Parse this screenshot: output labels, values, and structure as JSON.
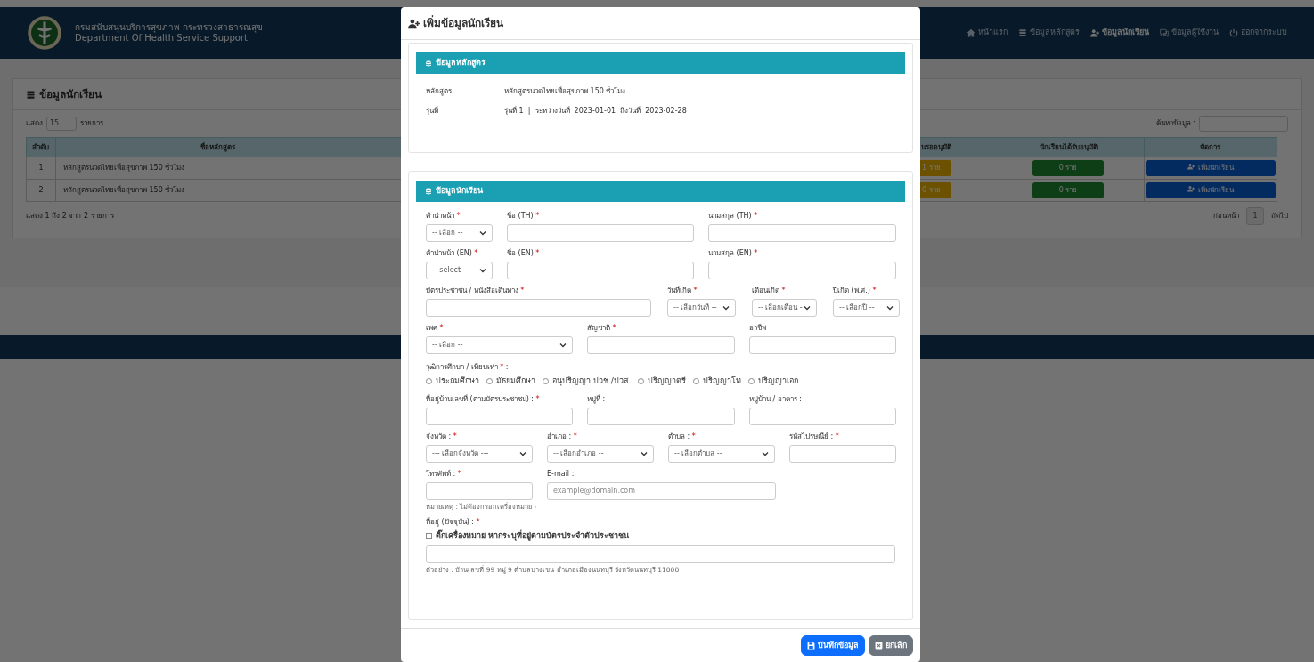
{
  "header": {
    "org_th": "กรมสนับสนุนบริการสุขภาพ กระทรวงสาธารณสุข",
    "org_en": "Department Of Health Service Support",
    "nav": [
      {
        "label": "หน้าแรก",
        "selected": false
      },
      {
        "label": "ข้อมูลหลักสูตร",
        "selected": false
      },
      {
        "label": "ข้อมูลนักเรียน",
        "selected": true
      },
      {
        "label": "ข้อมูลผู้ใช้งาน",
        "selected": false
      },
      {
        "label": "ออกจากระบบ",
        "selected": false
      }
    ]
  },
  "page": {
    "title": "ข้อมูลนักเรียน",
    "length_prefix": "แสดง",
    "length_value": "15",
    "length_suffix": "รายการ",
    "search_label": "ค้นหาข้อมูล :",
    "columns": [
      "ลำดับ",
      "ชื่อหลักสูตร",
      "นรออนุมัติ",
      "นักเรียนได้รับอนุมัติ",
      "จัดการ"
    ],
    "rows": [
      {
        "no": "1",
        "course": "หลักสูตรนวดไทยเพื่อสุขภาพ 150 ชั่วโมง",
        "pending": "1 ราย",
        "approved": "0 ราย",
        "action": "เพิ่มนักเรียน"
      },
      {
        "no": "2",
        "course": "หลักสูตรนวดไทยเพื่อสุขภาพ 150 ชั่วโมง",
        "pending": "0 ราย",
        "approved": "0 ราย",
        "action": "เพิ่มนักเรียน"
      }
    ],
    "info": "แสดง 1 ถึง 2 จาก 2 รายการ",
    "pagination": {
      "prev": "ก่อนหน้า",
      "page": "1",
      "next": "ถัดไป"
    }
  },
  "modal": {
    "title": "เพิ่มข้อมูลนักเรียน",
    "course_panel": {
      "title": "ข้อมูลหลักสูตร",
      "fields": [
        {
          "label": "หลักสูตร",
          "value": "หลักสูตรนวดไทยเพื่อสุขภาพ 150 ชั่วโมง"
        },
        {
          "label": "รุ่นที่",
          "value": "รุ่นที่ 1  |  ระหว่างวันที่  2023-01-01  ถึงวันที่  2023-02-28"
        }
      ]
    },
    "student_panel": {
      "title": "ข้อมูลนักเรียน",
      "rows": [
        {
          "kind": "fields",
          "fields": [
            {
              "kind": "select",
              "label": "คำนำหน้า",
              "required": "*",
              "value": "-- เลือก --"
            },
            {
              "kind": "input",
              "label": "ชื่อ (TH)",
              "required": "*"
            },
            {
              "kind": "input",
              "label": "นามสกุล (TH)",
              "required": "*"
            }
          ]
        },
        {
          "kind": "fields",
          "fields": [
            {
              "kind": "select",
              "label": "คำนำหน้า (EN)",
              "required": "*",
              "value": "-- select --"
            },
            {
              "kind": "input",
              "label": "ชื่อ (EN)",
              "required": "*"
            },
            {
              "kind": "input",
              "label": "นามสกุล (EN)",
              "required": "*"
            }
          ]
        },
        {
          "kind": "fields",
          "fields": [
            {
              "kind": "input",
              "label": "บัตรประชาชน / หนังสือเดินทาง",
              "required": "*"
            },
            {
              "kind": "select",
              "label": "วันที่เกิด",
              "required": "*",
              "value": "-- เลือกวันที่ --"
            },
            {
              "kind": "select",
              "label": "เดือนเกิด",
              "required": "*",
              "value": "-- เลือกเดือน -"
            },
            {
              "kind": "select",
              "label": "ปีเกิด (พ.ศ.)",
              "required": "*",
              "value": "-- เลือกปี --"
            }
          ]
        },
        {
          "kind": "fields",
          "fields": [
            {
              "kind": "select",
              "label": "เพศ",
              "required": "*",
              "value": "-- เลือก --"
            },
            {
              "kind": "input",
              "label": "สัญชาติ",
              "required": "*"
            },
            {
              "kind": "input",
              "label": "อาชีพ"
            }
          ]
        },
        {
          "kind": "radio",
          "label": "วุฒิการศึกษา / เทียบเท่า",
          "required": "*",
          "suffix": ":",
          "options": [
            {
              "label": "ประถมศึกษา",
              "selected": false
            },
            {
              "label": "มัธยมศึกษา",
              "selected": false
            },
            {
              "label": "อนุปริญญา ปวช./ปวส.",
              "selected": false
            },
            {
              "label": "ปริญญาตรี",
              "selected": false
            },
            {
              "label": "ปริญญาโท",
              "selected": false
            },
            {
              "label": "ปริญญาเอก",
              "selected": false
            }
          ]
        },
        {
          "kind": "fields",
          "fields": [
            {
              "kind": "input",
              "label": "ที่อยู่บ้านเลขที่ (ตามบัตรประชาชน) :",
              "required": "*"
            },
            {
              "kind": "input",
              "label": "หมู่ที่ :"
            },
            {
              "kind": "input",
              "label": "หมู่บ้าน / อาคาร :"
            }
          ]
        },
        {
          "kind": "fields",
          "fields": [
            {
              "kind": "select",
              "label": "จังหวัด :",
              "required": "*",
              "value": "--- เลือกจังหวัด ---"
            },
            {
              "kind": "select",
              "label": "อำเภอ :",
              "required": "*",
              "value": "-- เลือกอำเภอ --"
            },
            {
              "kind": "select",
              "label": "ตำบล :",
              "required": "*",
              "value": "-- เลือกตำบล --"
            },
            {
              "kind": "input",
              "label": "รหัสไปรษณีย์ :",
              "required": "*"
            }
          ]
        },
        {
          "kind": "fields",
          "fields": [
            {
              "kind": "input",
              "label": "โทรศัพท์ :",
              "required": "*",
              "hint": "หมายเหตุ : ไม่ต้องกรอกเครื่องหมาย -"
            },
            {
              "kind": "input",
              "label": "E-mail :",
              "placeholder": "example@domain.com"
            }
          ]
        },
        {
          "kind": "address",
          "label": "ที่อยู่ (ปัจจุบัน) :",
          "required": "*",
          "checkbox": {
            "label": "ติ๊กเครื่องหมาย หากระบุที่อยู่ตามบัตรประจำตัวประชาชน",
            "checked": false
          },
          "hint": "ตัวอย่าง : บ้านเลขที่ 99 หมู่ 9 ตำบลบางเขน อำเภอเมืองนนทบุรี จังหวัดนนทบุรี 11000"
        }
      ]
    },
    "buttons": [
      {
        "kind": "save",
        "label": "บันทึกข้อมูล"
      },
      {
        "kind": "cancel",
        "label": "ยกเลิก"
      }
    ]
  }
}
